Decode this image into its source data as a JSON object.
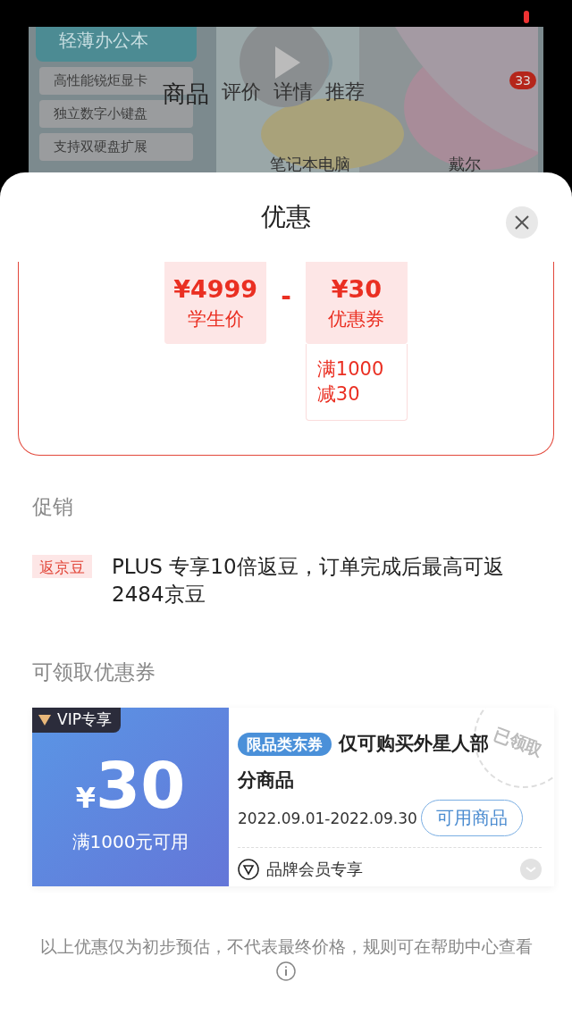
{
  "background_page": {
    "side_tags": [
      "轻薄办公本",
      "高性能锐炬显卡",
      "独立数字小键盘",
      "支持双硬盘扩展"
    ],
    "tabs": [
      {
        "label": "商品",
        "selected": true
      },
      {
        "label": "评价",
        "selected": false
      },
      {
        "label": "详情",
        "selected": false
      },
      {
        "label": "推荐",
        "selected": false
      }
    ],
    "badge": "33",
    "bottom_labels": [
      "笔记本电脑",
      "戴尔"
    ]
  },
  "sheet": {
    "title": "优惠",
    "calculation": {
      "items": [
        {
          "amount": "¥4999",
          "label": "学生价"
        },
        {
          "amount": "¥30",
          "label": "优惠券",
          "detail": "满1000\n减30"
        }
      ],
      "operator": "-"
    },
    "promotion": {
      "heading": "促销",
      "tag": "返京豆",
      "text": "PLUS 专享10倍返豆，订单完成后最高可返2484京豆"
    },
    "coupons": {
      "heading": "可领取优惠券",
      "items": [
        {
          "vip_tag": "VIP专享",
          "currency": "¥",
          "amount": "30",
          "condition": "满1000元可用",
          "category_tag": "限品类东券",
          "title": "仅可购买外星人部分商品",
          "validity": "2022.09.01-2022.09.30",
          "button": "可用商品",
          "member_note": "品牌会员专享",
          "stamp": "已领取",
          "claimed": true
        }
      ]
    },
    "footer": "以上优惠仅为初步预估，不代表最终价格，规则可在帮助中心查看"
  }
}
